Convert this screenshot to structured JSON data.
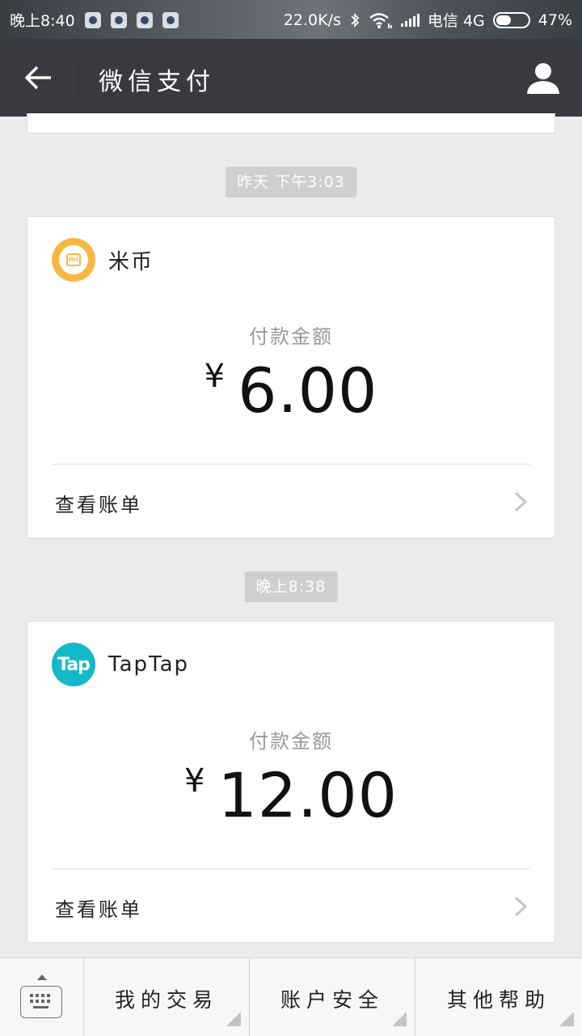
{
  "status_bar": {
    "time": "晚上8:40",
    "network_speed": "22.0K/s",
    "carrier": "电信 4G",
    "battery": "47%",
    "battery_level": 0.47
  },
  "header": {
    "title": "微信支付"
  },
  "transactions": [
    {
      "time_label": "昨天 下午3:03",
      "merchant": "米币",
      "amount_label": "付款金额",
      "currency": "¥",
      "amount": "6.00",
      "bill_link": "查看账单",
      "logo_icon": "mi-logo-icon",
      "logo_color": "#f7b843"
    },
    {
      "time_label": "晚上8:38",
      "merchant": "TapTap",
      "logo_text": "Tap",
      "amount_label": "付款金额",
      "currency": "¥",
      "amount": "12.00",
      "bill_link": "查看账单",
      "logo_icon": "taptap-logo-icon",
      "logo_color": "#14b9c8"
    }
  ],
  "bottom_menu": {
    "items": [
      "我的交易",
      "账户安全",
      "其他帮助"
    ]
  },
  "colors": {
    "header_bg": "#393a3f",
    "page_bg": "#ebebeb",
    "time_badge_bg": "#cfcfcf"
  }
}
